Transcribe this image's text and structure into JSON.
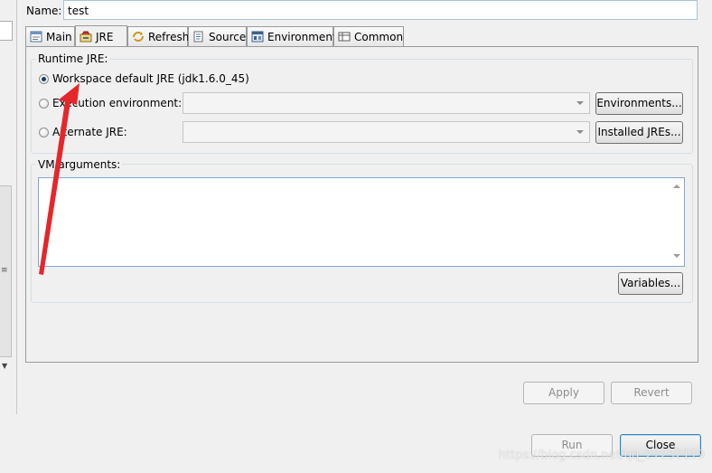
{
  "name_row": {
    "label": "Name:",
    "value": "test"
  },
  "tabs": [
    {
      "label": "Main",
      "icon": "main-tab-icon"
    },
    {
      "label": "JRE",
      "icon": "jre-tab-icon",
      "active": true
    },
    {
      "label": "Refresh",
      "icon": "refresh-tab-icon"
    },
    {
      "label": "Source",
      "icon": "source-tab-icon"
    },
    {
      "label": "Environment",
      "icon": "environment-tab-icon"
    },
    {
      "label": "Common",
      "icon": "common-tab-icon"
    }
  ],
  "runtime_jre": {
    "title": "Runtime JRE:",
    "options": [
      {
        "label": "Workspace default JRE (jdk1.6.0_45)",
        "selected": true
      },
      {
        "label": "Execution environment:",
        "selected": false
      },
      {
        "label": "Alternate JRE:",
        "selected": false
      }
    ],
    "environments_button": "Environments...",
    "installed_jres_button": "Installed JREs..."
  },
  "vm_arguments": {
    "title": "VM arguments:",
    "value": "",
    "variables_button": "Variables..."
  },
  "footer": {
    "apply": "Apply",
    "revert": "Revert",
    "run": "Run",
    "close": "Close"
  },
  "watermark": "https://blog.csdn.net/qq_27232119",
  "colors": {
    "annotation_arrow": "#e5262a",
    "focus_border": "#7ea9d3"
  }
}
